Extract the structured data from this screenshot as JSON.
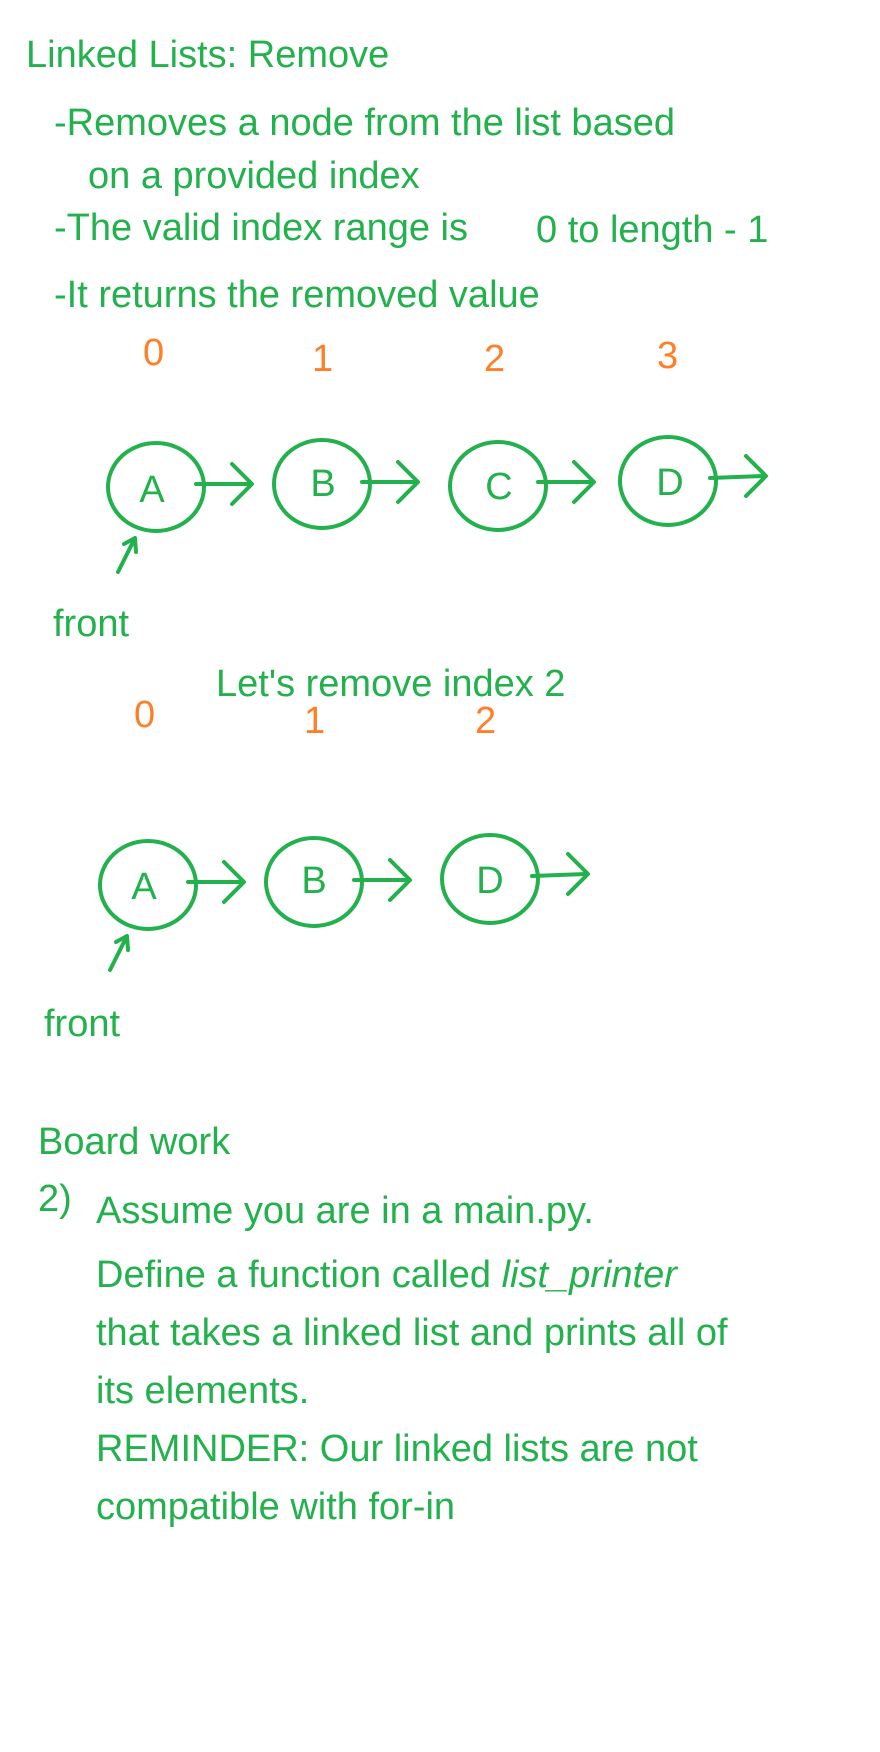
{
  "title": "Linked Lists: Remove",
  "bullets": [
    "-Removes a node from the list based",
    "on a provided index",
    "-The valid index range is",
    "0 to length - 1",
    "-It returns the removed value"
  ],
  "before": {
    "indices": [
      "0",
      "1",
      "2",
      "3"
    ],
    "nodes": [
      "A",
      "B",
      "C",
      "D"
    ],
    "front_label": "front"
  },
  "caption": "Let's remove index 2",
  "after": {
    "indices": [
      "0",
      "1",
      "2"
    ],
    "nodes": [
      "A",
      "B",
      "D"
    ],
    "front_label": "front"
  },
  "board_work": {
    "heading": "Board work",
    "number": "2)",
    "line1": "Assume you are in a main.py.",
    "line2_prefix": "Define a function called ",
    "line2_em": "list_printer",
    "line3": "that takes a linked list and prints all of",
    "line4": "its elements.",
    "line5": "REMINDER: Our linked lists are not",
    "line6": "compatible with for-in"
  },
  "colors": {
    "green": "#22b14c",
    "orange": "#ff7f27",
    "background": "#ffffff"
  }
}
